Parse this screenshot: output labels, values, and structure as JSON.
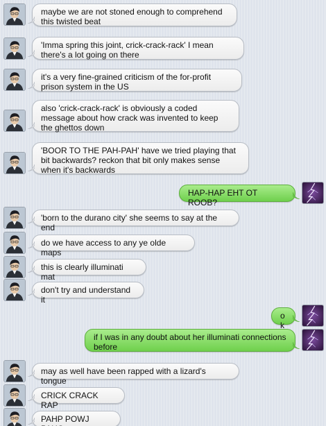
{
  "chat": {
    "colors": {
      "incoming_bubble": "#f2f2f2",
      "outgoing_bubble": "#8fe070",
      "background": "#dfe4ec"
    },
    "avatars": {
      "incoming": "person-photo-avatar",
      "outgoing": "purple-lightning-avatar"
    },
    "messages": [
      {
        "from": "them",
        "text": "maybe we are not stoned enough to comprehend this twisted beat"
      },
      {
        "from": "them",
        "text": "'Imma spring this joint, crick-crack-rack' I mean there's a lot going on there"
      },
      {
        "from": "them",
        "text": "it's a very fine-grained criticism of the for-profit prison system in the US"
      },
      {
        "from": "them",
        "text": "also 'crick-crack-rack' is obviously a coded message about how crack was invented to keep the ghettos down"
      },
      {
        "from": "them",
        "text": "'BOOR TO THE PAH-PAH' have we tried playing that bit backwards? reckon that bit only makes sense when it's backwards"
      },
      {
        "from": "me",
        "text": "HAP-HAP EHT OT ROOB?"
      },
      {
        "from": "them",
        "text": "'born to the durano city' she seems to say at the end"
      },
      {
        "from": "them",
        "text": "do we have access to any ye olde maps"
      },
      {
        "from": "them",
        "text": "this is clearly illuminati mat"
      },
      {
        "from": "them",
        "text": "don't try and understand it"
      },
      {
        "from": "me",
        "text": "ok"
      },
      {
        "from": "me",
        "text": "if I was in any doubt about her illuminati connections before"
      },
      {
        "from": "them",
        "text": "may as well have been rapped with a lizard's tongue"
      },
      {
        "from": "them",
        "text": "CRICK CRACK RAP"
      },
      {
        "from": "them",
        "text": "PAHP POWJ PAHG"
      }
    ]
  }
}
